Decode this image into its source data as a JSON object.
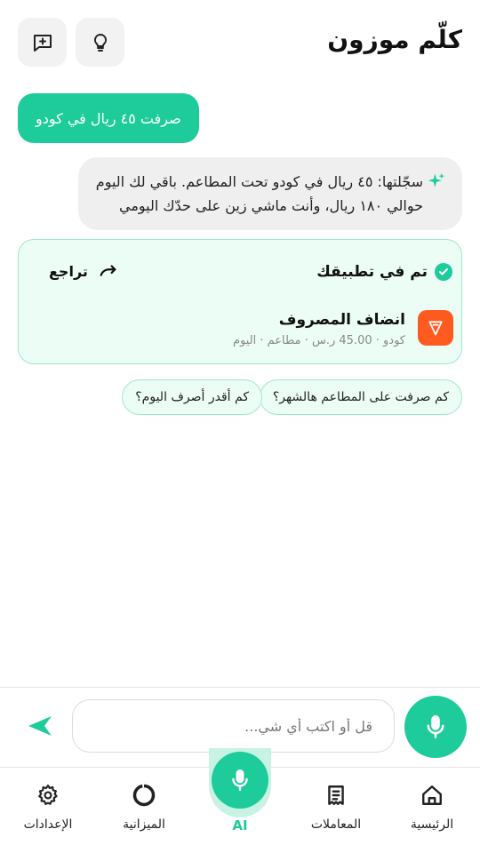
{
  "header": {
    "title": "كلّم موزون",
    "buttons": [
      "new-chat-icon",
      "lightbulb-icon"
    ]
  },
  "chat": {
    "user_message": "صرفت ٤٥ ريال في كودو",
    "ai_message_line1": "سجّلتها: ٤٥ ريال في كودو تحت المطاعم. باقي لك اليوم",
    "ai_message_line2": "حوالي ١٨٠ ريال، وأنت ماشي زين على حدّك اليومي"
  },
  "card": {
    "status": "تم في تطبيقك",
    "undo_label": "تراجع",
    "transaction_title": "انضاف المصروف",
    "transaction_meta": "كودو · 45.00 ر.س · مطاعم · اليوم"
  },
  "suggestions": [
    "كم صرفت على المطاعم هالشهر؟",
    "كم أقدر أصرف اليوم؟"
  ],
  "composer": {
    "placeholder": "قل أو اكتب أي شي..."
  },
  "nav": {
    "home": "الرئيسية",
    "transactions": "المعاملات",
    "ai": "AI",
    "budget": "الميزانية",
    "settings": "الإعدادات"
  },
  "colors": {
    "accent": "#1ecb9a",
    "accent_light": "#ecfdf6",
    "merchant": "#ff5a1f"
  }
}
